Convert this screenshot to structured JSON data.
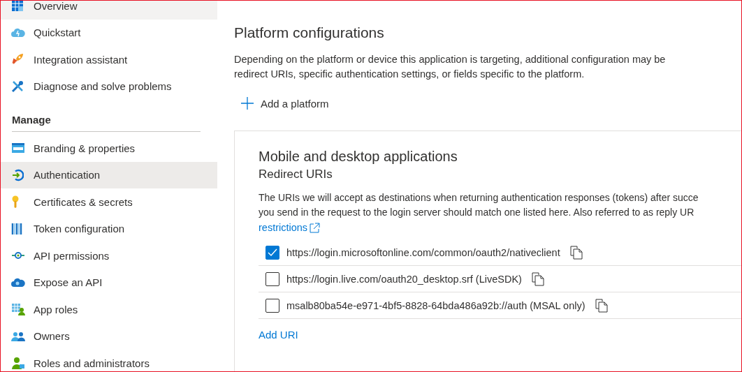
{
  "sidebar": {
    "items": [
      {
        "label": "Overview",
        "hovered": true
      },
      {
        "label": "Quickstart",
        "hovered": false
      },
      {
        "label": "Integration assistant",
        "hovered": false
      },
      {
        "label": "Diagnose and solve problems",
        "hovered": false
      }
    ],
    "section": "Manage",
    "manage_items": [
      {
        "label": "Branding & properties",
        "selected": false
      },
      {
        "label": "Authentication",
        "selected": true
      },
      {
        "label": "Certificates & secrets",
        "selected": false
      },
      {
        "label": "Token configuration",
        "selected": false
      },
      {
        "label": "API permissions",
        "selected": false
      },
      {
        "label": "Expose an API",
        "selected": false
      },
      {
        "label": "App roles",
        "selected": false
      },
      {
        "label": "Owners",
        "selected": false
      },
      {
        "label": "Roles and administrators",
        "selected": false
      }
    ]
  },
  "main": {
    "title": "Platform configurations",
    "description": [
      "Depending on the platform or device this application is targeting, additional configuration may be",
      "redirect URIs, specific authentication settings, or fields specific to the platform."
    ],
    "add_button": "Add a platform",
    "card": {
      "title": "Mobile and desktop applications",
      "subtitle": "Redirect URIs",
      "description": [
        "The URIs we will accept as destinations when returning authentication responses (tokens) after succe",
        "you send in the request to the login server should match one listed here. Also referred to as reply UR"
      ],
      "link": "restrictions",
      "uris": [
        {
          "value": "https://login.microsoftonline.com/common/oauth2/nativeclient",
          "checked": true
        },
        {
          "value": "https://login.live.com/oauth20_desktop.srf (LiveSDK)",
          "checked": false
        },
        {
          "value": "msalb80ba54e-e971-4bf5-8828-64bda486a92b://auth (MSAL only)",
          "checked": false
        }
      ],
      "add_uri": "Add URI"
    }
  }
}
